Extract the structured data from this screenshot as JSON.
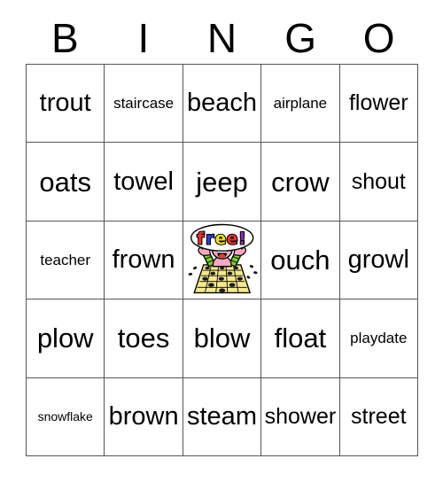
{
  "card": {
    "title": "BINGO",
    "columns": [
      "B",
      "I",
      "N",
      "G",
      "O"
    ],
    "grid_size": "5x5",
    "background_color": "#ffffff",
    "grid_line_color": "#555555",
    "text_color": "#000000"
  },
  "header": {
    "letters": [
      {
        "label": "B"
      },
      {
        "label": "I"
      },
      {
        "label": "N"
      },
      {
        "label": "G"
      },
      {
        "label": "O"
      }
    ]
  },
  "rows": [
    {
      "cells": [
        {
          "label": "trout",
          "size": "lg"
        },
        {
          "label": "staircase",
          "size": "sm"
        },
        {
          "label": "beach",
          "size": "lg"
        },
        {
          "label": "airplane",
          "size": "sm"
        },
        {
          "label": "flower",
          "size": "md"
        }
      ]
    },
    {
      "cells": [
        {
          "label": "oats",
          "size": "xl"
        },
        {
          "label": "towel",
          "size": "lg"
        },
        {
          "label": "jeep",
          "size": "xl"
        },
        {
          "label": "crow",
          "size": "xl"
        },
        {
          "label": "shout",
          "size": "md"
        }
      ]
    },
    {
      "cells": [
        {
          "label": "teacher",
          "size": "sm"
        },
        {
          "label": "frown",
          "size": "lg"
        },
        {
          "label": "",
          "size": "md",
          "free_space": true
        },
        {
          "label": "ouch",
          "size": "xl"
        },
        {
          "label": "growl",
          "size": "lg"
        }
      ]
    },
    {
      "cells": [
        {
          "label": "plow",
          "size": "xl"
        },
        {
          "label": "toes",
          "size": "xl"
        },
        {
          "label": "blow",
          "size": "xl"
        },
        {
          "label": "float",
          "size": "xl"
        },
        {
          "label": "playdate",
          "size": "sm"
        }
      ]
    },
    {
      "cells": [
        {
          "label": "snowflake",
          "size": "xs"
        },
        {
          "label": "brown",
          "size": "lg"
        },
        {
          "label": "steam",
          "size": "lg"
        },
        {
          "label": "shower",
          "size": "md"
        },
        {
          "label": "street",
          "size": "md"
        }
      ]
    }
  ],
  "free_space": {
    "word": "free!",
    "letters": [
      {
        "char": "f",
        "color": "#e8342a"
      },
      {
        "char": "r",
        "color": "#2b3fd0"
      },
      {
        "char": "e",
        "color": "#f2e21a"
      },
      {
        "char": "e",
        "color": "#e8342a"
      },
      {
        "char": "!",
        "color": "#8e2fb0"
      }
    ],
    "colors": {
      "bubble": "#ffffff",
      "outline": "#000000",
      "skin": "#f4a9c0",
      "sleeve": "#7ed321",
      "card": "#f5ea8a",
      "marker": "#1a1a1a",
      "mouth": "#e8342a"
    }
  }
}
